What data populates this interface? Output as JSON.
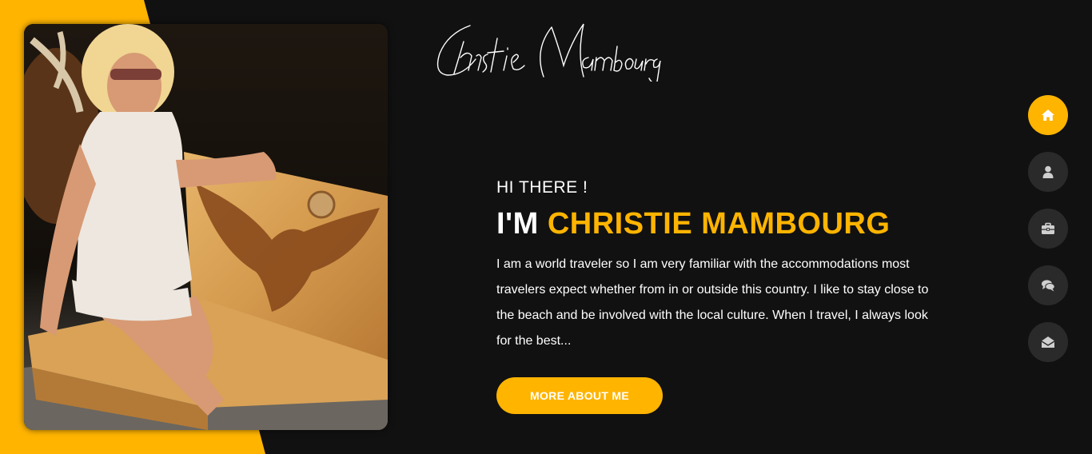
{
  "site": {
    "signature_text": "Christie Mambourg"
  },
  "hero": {
    "greeting": "HI THERE !",
    "headline_prefix": "I'M",
    "headline_name": "CHRISTIE MAMBOURG",
    "bio": "I am a world traveler so I am very familiar with the accommodations most travelers expect whether from in or outside this country. I like to stay close to the beach and be involved with the local culture. When I travel, I always look for the best...",
    "button_label": "MORE ABOUT ME"
  },
  "nav": {
    "items": [
      {
        "icon": "home-icon",
        "active": true
      },
      {
        "icon": "user-icon",
        "active": false
      },
      {
        "icon": "briefcase-icon",
        "active": false
      },
      {
        "icon": "comments-icon",
        "active": false
      },
      {
        "icon": "envelope-open-icon",
        "active": false
      }
    ]
  },
  "colors": {
    "accent": "#ffb400",
    "background": "#111111",
    "nav_inactive": "#2b2a2a"
  }
}
